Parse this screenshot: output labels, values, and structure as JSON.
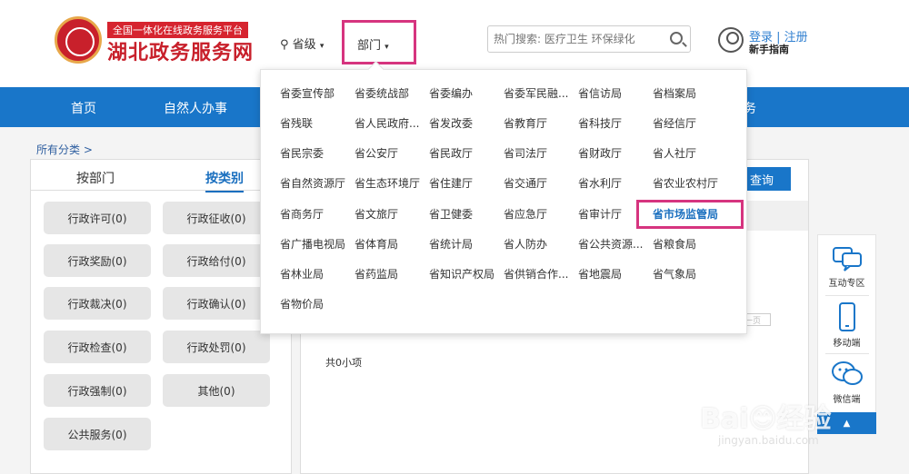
{
  "header": {
    "tag": "全国一体化在线政务服务平台",
    "title": "湖北政务服务网",
    "province_label": "省级",
    "dept_label": "部门",
    "search_placeholder": "热门搜索: 医疗卫生 环保绿化",
    "login": "登录 | 注册",
    "help": "新手指南"
  },
  "nav": {
    "items": [
      "首页",
      "自然人办事"
    ],
    "trailing_fragment": "务"
  },
  "breadcrumb": "所有分类 >",
  "left_panel": {
    "tabs": [
      "按部门",
      "按类别"
    ],
    "active_tab": 1,
    "categories": [
      "行政许可(0)",
      "行政征收(0)",
      "行政奖励(0)",
      "行政给付(0)",
      "行政裁决(0)",
      "行政确认(0)",
      "行政检查(0)",
      "行政处罚(0)",
      "行政强制(0)",
      "其他(0)",
      "公共服务(0)"
    ]
  },
  "main": {
    "query_button": "查询",
    "count": "共0小项",
    "pager_ghost": "一页"
  },
  "dropdown": {
    "departments": [
      [
        "省委宣传部",
        "省委统战部",
        "省委编办",
        "省委军民融...",
        "省信访局",
        "省档案局"
      ],
      [
        "省残联",
        "省人民政府...",
        "省发改委",
        "省教育厅",
        "省科技厅",
        "省经信厅"
      ],
      [
        "省民宗委",
        "省公安厅",
        "省民政厅",
        "省司法厅",
        "省财政厅",
        "省人社厅"
      ],
      [
        "省自然资源厅",
        "省生态环境厅",
        "省住建厅",
        "省交通厅",
        "省水利厅",
        "省农业农村厅"
      ],
      [
        "省商务厅",
        "省文旅厅",
        "省卫健委",
        "省应急厅",
        "省审计厅",
        "省市场监管局"
      ],
      [
        "省广播电视局",
        "省体育局",
        "省统计局",
        "省人防办",
        "省公共资源...",
        "省粮食局"
      ],
      [
        "省林业局",
        "省药监局",
        "省知识产权局",
        "省供销合作...",
        "省地震局",
        "省气象局"
      ],
      [
        "省物价局"
      ]
    ],
    "highlighted": "省市场监管局"
  },
  "sidebar": {
    "items": [
      "互动专区",
      "移动端",
      "微信端"
    ],
    "top_button": "▲"
  },
  "watermark": {
    "text": "Bai😊经验",
    "url": "jingyan.baidu.com"
  },
  "colors": {
    "brand_red": "#c8202b",
    "nav_blue": "#1976c9",
    "highlight_pink": "#d6347f",
    "active_blue": "#1a6fbf"
  }
}
